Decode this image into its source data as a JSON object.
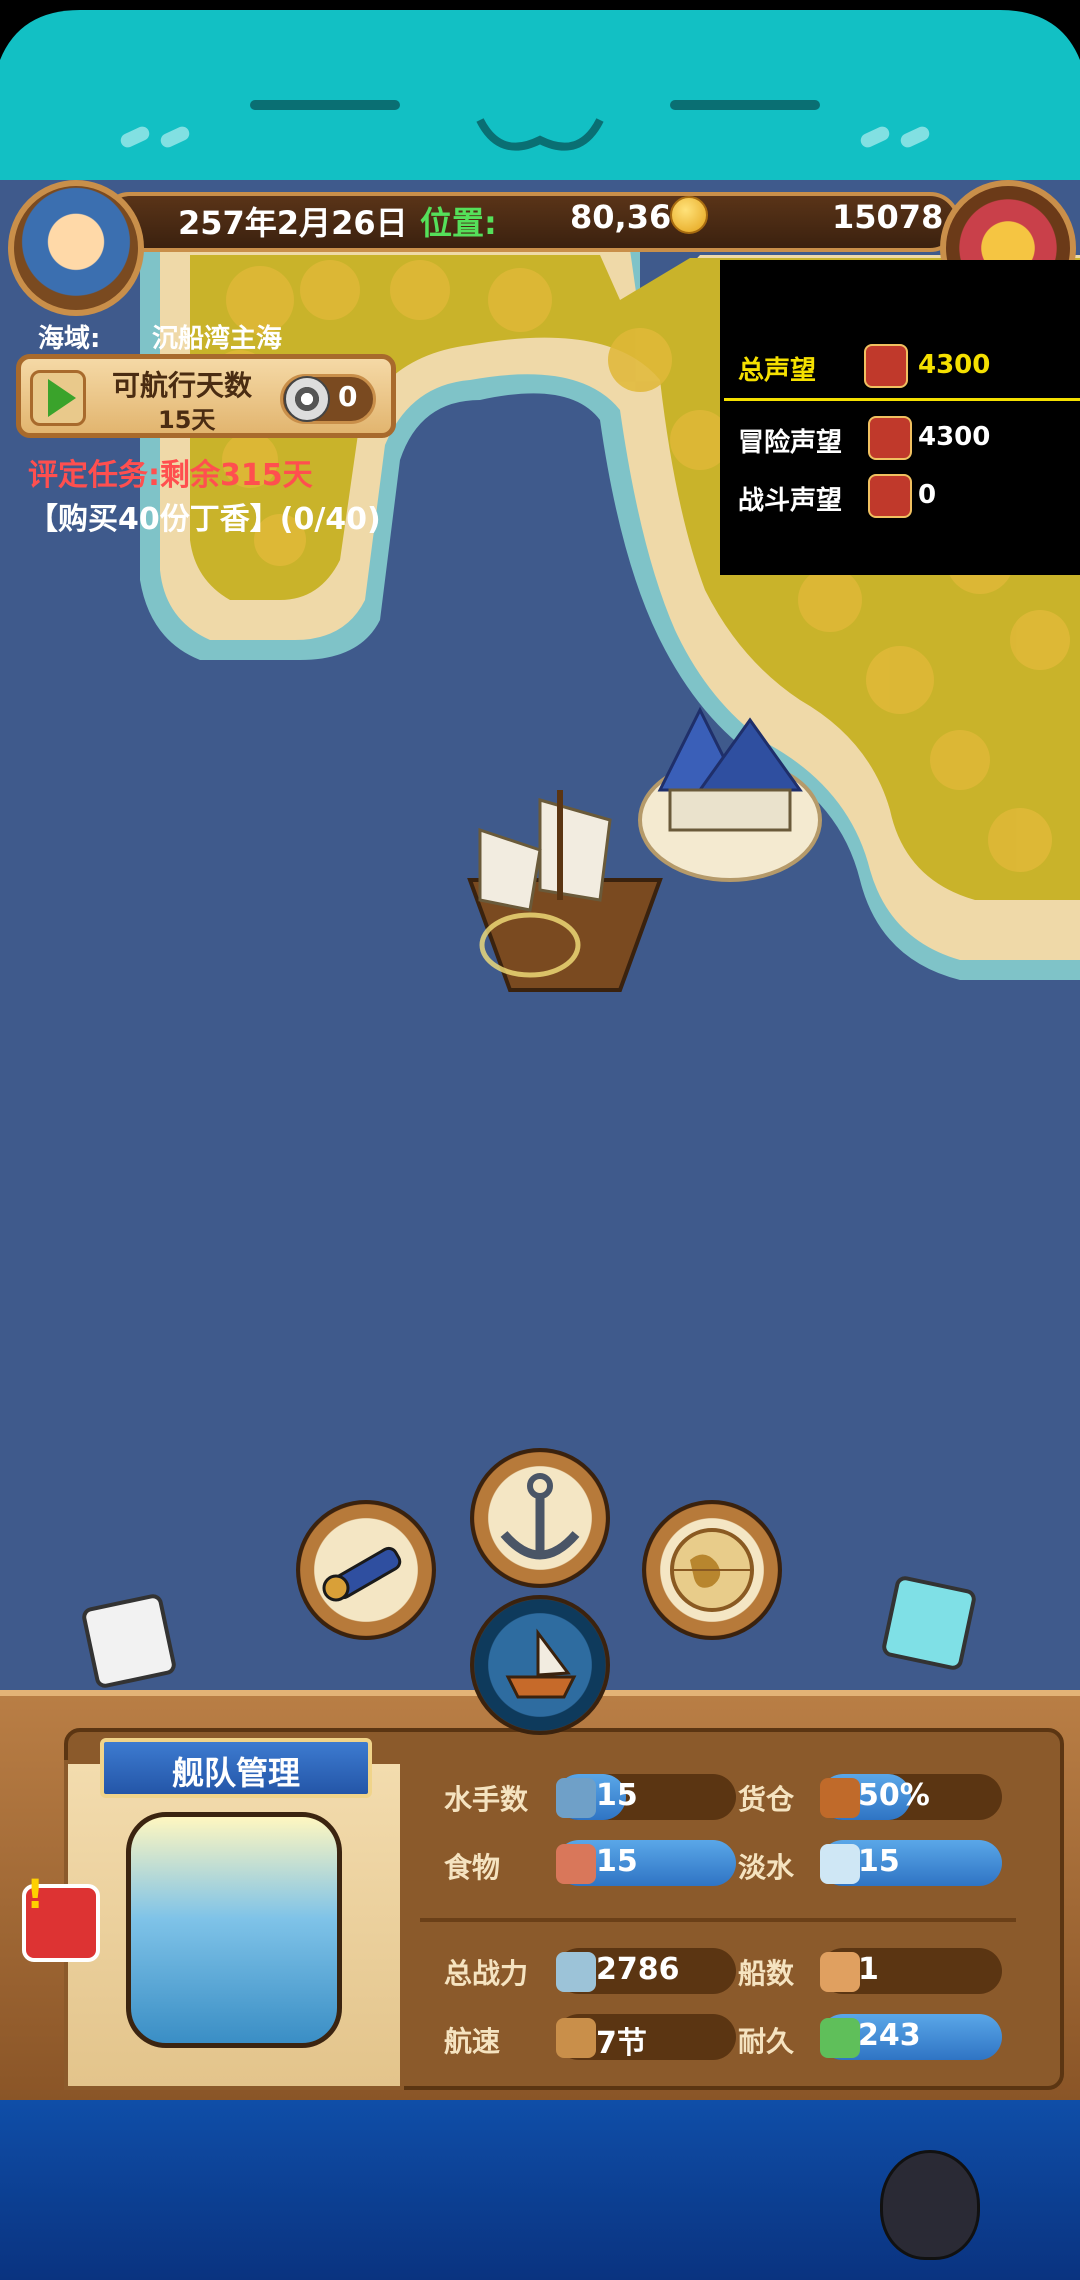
{
  "hud": {
    "date": "257年2月26日",
    "position_label": "位置:",
    "position_value": "80,36",
    "gold": "15078"
  },
  "sea": {
    "label": "海域:",
    "value": "沉船湾主海"
  },
  "sail": {
    "title": "可航行天数",
    "days": "15天",
    "token_count": "0"
  },
  "mission": {
    "status": "评定任务:剩余315天",
    "task": "【购买40份丁香】(0/40)"
  },
  "reputation": {
    "total_label": "总声望",
    "total_value": "4300",
    "adventure_label": "冒险声望",
    "adventure_value": "4300",
    "battle_label": "战斗声望",
    "battle_value": "0"
  },
  "fleet": {
    "title": "舰队管理",
    "sailors_label": "水手数",
    "sailors_value": "15",
    "cargo_label": "货仓",
    "cargo_value": "50%",
    "food_label": "食物",
    "food_value": "15",
    "water_label": "淡水",
    "water_value": "15",
    "power_label": "总战力",
    "power_value": "2786",
    "ships_label": "船数",
    "ships_value": "1",
    "speed_label": "航速",
    "speed_value": "7节",
    "durability_label": "耐久",
    "durability_value": "243"
  },
  "colors": {
    "accent_red": "#ff4f4f",
    "rep_yellow": "#f5e000",
    "ocean": "#3f5a8c",
    "bar_blue": "#2f74c4"
  },
  "icons": [
    "telescope-icon",
    "anchor-icon",
    "globe-icon",
    "ship-icon",
    "treasure-chest-icon",
    "coin-icon"
  ]
}
